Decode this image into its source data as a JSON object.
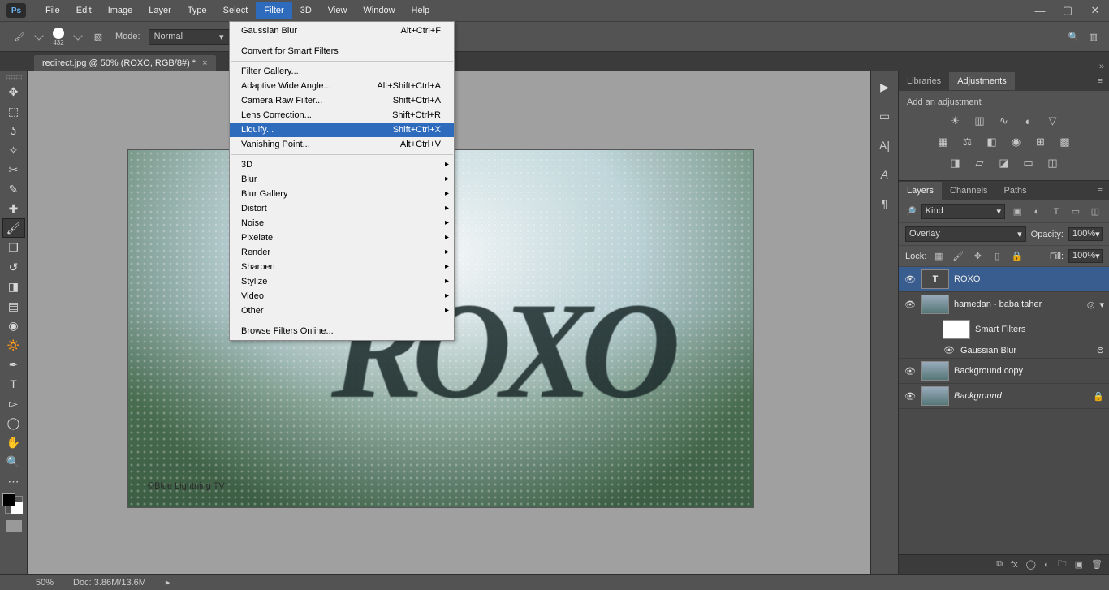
{
  "app": {
    "logo": "Ps"
  },
  "menubar": [
    "File",
    "Edit",
    "Image",
    "Layer",
    "Type",
    "Select",
    "Filter",
    "3D",
    "View",
    "Window",
    "Help"
  ],
  "menubar_open_index": 6,
  "filter_menu": {
    "groups": [
      [
        {
          "label": "Gaussian Blur",
          "shortcut": "Alt+Ctrl+F"
        }
      ],
      [
        {
          "label": "Convert for Smart Filters"
        }
      ],
      [
        {
          "label": "Filter Gallery..."
        },
        {
          "label": "Adaptive Wide Angle...",
          "shortcut": "Alt+Shift+Ctrl+A"
        },
        {
          "label": "Camera Raw Filter...",
          "shortcut": "Shift+Ctrl+A"
        },
        {
          "label": "Lens Correction...",
          "shortcut": "Shift+Ctrl+R"
        },
        {
          "label": "Liquify...",
          "shortcut": "Shift+Ctrl+X",
          "highlight": true
        },
        {
          "label": "Vanishing Point...",
          "shortcut": "Alt+Ctrl+V"
        }
      ],
      [
        {
          "label": "3D",
          "sub": true
        },
        {
          "label": "Blur",
          "sub": true
        },
        {
          "label": "Blur Gallery",
          "sub": true
        },
        {
          "label": "Distort",
          "sub": true
        },
        {
          "label": "Noise",
          "sub": true
        },
        {
          "label": "Pixelate",
          "sub": true
        },
        {
          "label": "Render",
          "sub": true
        },
        {
          "label": "Sharpen",
          "sub": true
        },
        {
          "label": "Stylize",
          "sub": true
        },
        {
          "label": "Video",
          "sub": true
        },
        {
          "label": "Other",
          "sub": true
        }
      ],
      [
        {
          "label": "Browse Filters Online..."
        }
      ]
    ]
  },
  "options_bar": {
    "brush_size": "432",
    "mode_label": "Mode:",
    "mode_value": "Normal"
  },
  "document_tab": "redirect.jpg @ 50% (ROXO, RGB/8#) *",
  "canvas": {
    "text": "ROXO",
    "watermark": "©Blue Lightning TV"
  },
  "adjustments_panel": {
    "tabs": [
      "Libraries",
      "Adjustments"
    ],
    "active_tab": 1,
    "heading": "Add an adjustment"
  },
  "layers_panel": {
    "tabs": [
      "Layers",
      "Channels",
      "Paths"
    ],
    "active_tab": 0,
    "filter_label": "Kind",
    "blend_mode": "Overlay",
    "opacity_label": "Opacity:",
    "opacity_value": "100%",
    "lock_label": "Lock:",
    "fill_label": "Fill:",
    "fill_value": "100%",
    "layers": [
      {
        "name": "ROXO",
        "type": "text",
        "selected": true
      },
      {
        "name": "hamedan - baba taher",
        "type": "smart",
        "smart_filters_label": "Smart Filters",
        "filter": "Gaussian Blur"
      },
      {
        "name": "Background copy",
        "type": "image"
      },
      {
        "name": "Background",
        "type": "image",
        "locked": true,
        "italic": true
      }
    ]
  },
  "status": {
    "zoom": "50%",
    "doc": "Doc: 3.86M/13.6M"
  }
}
